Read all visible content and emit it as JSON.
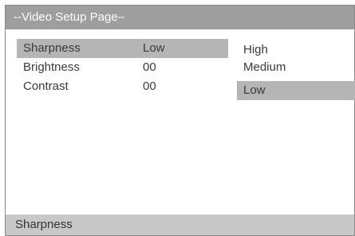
{
  "title": "--Video Setup Page–",
  "menu": {
    "items": [
      {
        "label": "Sharpness",
        "value": "Low"
      },
      {
        "label": "Brightness",
        "value": "00"
      },
      {
        "label": "Contrast",
        "value": "00"
      }
    ],
    "selected_index": 0
  },
  "options": {
    "items": [
      "High",
      "Medium",
      "Low"
    ],
    "selected": "Low"
  },
  "status": {
    "text": "Sharpness"
  },
  "colors": {
    "title_bar": "#9e9e9e",
    "highlight": "#b5b5b5",
    "status_bar": "#c8c8c8"
  }
}
